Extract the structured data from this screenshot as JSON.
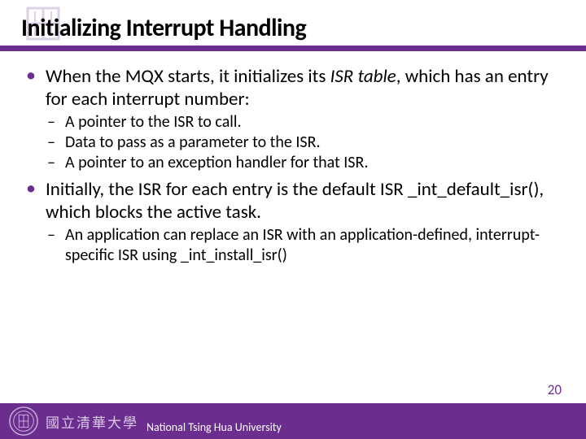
{
  "title": "Initializing Interrupt Handling",
  "bullets": [
    {
      "text_parts": [
        "When the MQX starts, it initializes its ",
        "ISR table",
        ", which has an entry for each interrupt number:"
      ],
      "italic_index": 1,
      "sub": [
        "A pointer to the ISR to call.",
        "Data to pass as a parameter to the ISR.",
        "A pointer to an exception handler for that ISR."
      ]
    },
    {
      "text": "Initially, the ISR for each entry is the default ISR _int_default_isr(), which blocks the active task.",
      "sub": [
        "An application can replace an ISR with an application-defined, interrupt-specific ISR using _int_install_isr()"
      ]
    }
  ],
  "footer": {
    "cn": "國立清華大學",
    "en": "National Tsing Hua University"
  },
  "page_number": "20",
  "colors": {
    "accent": "#6b2e8f"
  }
}
